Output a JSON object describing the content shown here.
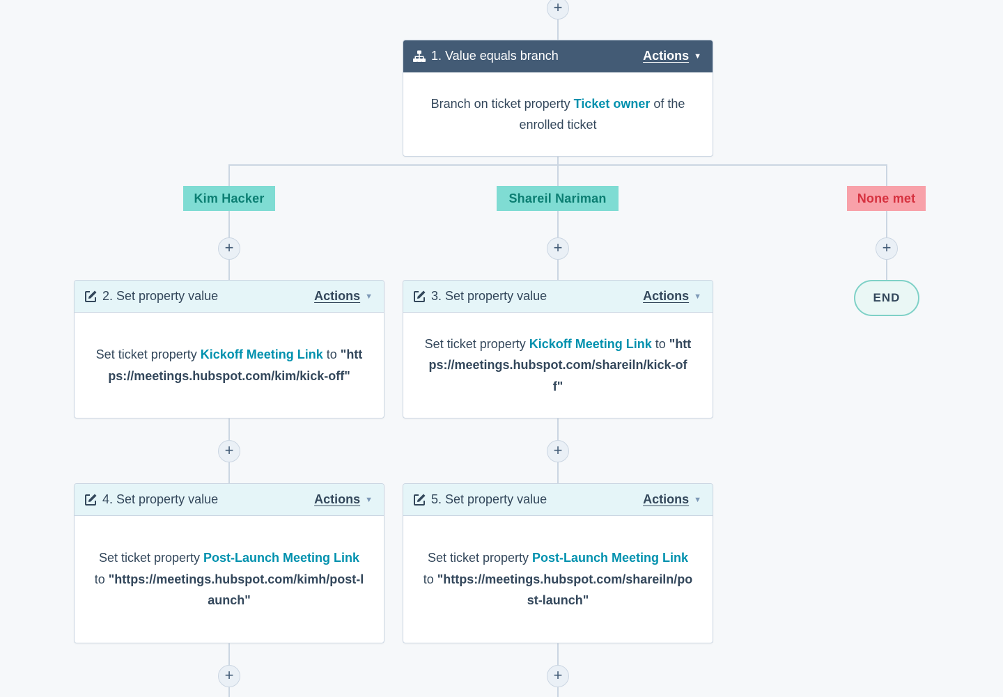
{
  "nodes": {
    "branch1": {
      "title": "1. Value equals branch",
      "actions_label": "Actions",
      "body_prefix": "Branch on ticket property ",
      "property": "Ticket owner",
      "body_suffix": " of the enrolled ticket"
    },
    "action2": {
      "title": "2. Set property value",
      "actions_label": "Actions",
      "prefix": "Set ticket property ",
      "property": "Kickoff Meeting Link",
      "to": " to ",
      "value": "\"https://meetings.hubspot.com/kim/kick-off\""
    },
    "action3": {
      "title": "3. Set property value",
      "actions_label": "Actions",
      "prefix": "Set ticket property ",
      "property": "Kickoff Meeting Link",
      "to": " to ",
      "value": "\"https://meetings.hubspot.com/shareiln/kick-off\""
    },
    "action4": {
      "title": "4. Set property value",
      "actions_label": "Actions",
      "prefix": "Set ticket property ",
      "property": "Post-Launch Meeting Link",
      "to": " to ",
      "value": "\"https://meetings.hubspot.com/kimh/post-launch\""
    },
    "action5": {
      "title": "5. Set property value",
      "actions_label": "Actions",
      "prefix": "Set ticket property ",
      "property": "Post-Launch Meeting Link",
      "to": " to ",
      "value": "\"https://meetings.hubspot.com/shareiln/post-launch\""
    }
  },
  "branches": {
    "kim": "Kim Hacker",
    "shareil": "Shareil Nariman",
    "none": "None met"
  },
  "end_label": "END",
  "plus_glyph": "+",
  "icons": {
    "branch": "branch-icon",
    "edit": "edit-icon",
    "caret": "caret-down-icon"
  },
  "colors": {
    "header_dark": "#435b75",
    "header_light": "#e5f5f8",
    "property_link": "#0091ae",
    "branch_teal_bg": "#7fdcd3",
    "branch_teal_text": "#0b7e72",
    "branch_red_bg": "#f8a1a9",
    "branch_red_text": "#d6313f"
  }
}
